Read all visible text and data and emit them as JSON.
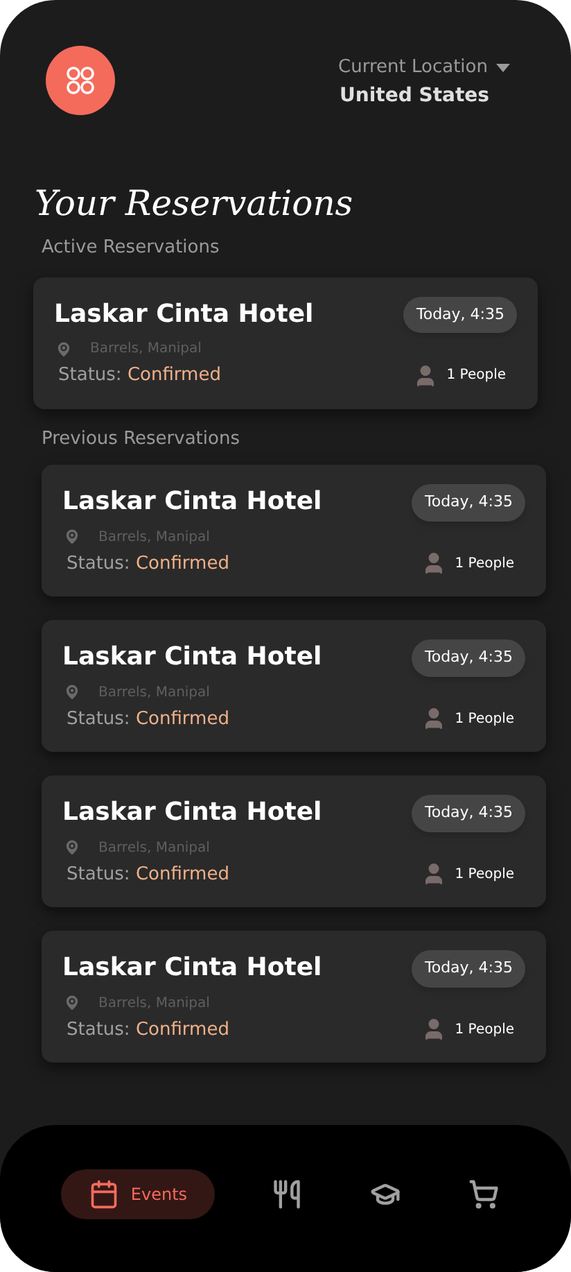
{
  "header": {
    "location_label": "Current Location",
    "location": "United States"
  },
  "title": "Your Reservations",
  "sections": [
    {
      "heading": "Active Reservations",
      "reservations": [
        {
          "name": "Laskar Cinta Hotel",
          "time": "Today, 4:35",
          "place": "Barrels, Manipal",
          "status_label": "Status:",
          "status": "Confirmed",
          "people": "1 People"
        }
      ]
    },
    {
      "heading": "Previous Reservations",
      "reservations": [
        {
          "name": "Laskar Cinta Hotel",
          "time": "Today, 4:35",
          "place": "Barrels, Manipal",
          "status_label": "Status:",
          "status": "Confirmed",
          "people": "1 People"
        },
        {
          "name": "Laskar Cinta Hotel",
          "time": "Today, 4:35",
          "place": "Barrels, Manipal",
          "status_label": "Status:",
          "status": "Confirmed",
          "people": "1 People"
        },
        {
          "name": "Laskar Cinta Hotel",
          "time": "Today, 4:35",
          "place": "Barrels, Manipal",
          "status_label": "Status:",
          "status": "Confirmed",
          "people": "1 People"
        },
        {
          "name": "Laskar Cinta Hotel",
          "time": "Today, 4:35",
          "place": "Barrels, Manipal",
          "status_label": "Status:",
          "status": "Confirmed",
          "people": "1 People"
        }
      ]
    }
  ],
  "nav": [
    {
      "kind": "calendar",
      "label": "Events",
      "selected": true
    },
    {
      "kind": "utensils",
      "selected": false
    },
    {
      "kind": "graduation",
      "selected": false
    },
    {
      "kind": "cart",
      "selected": false
    }
  ]
}
